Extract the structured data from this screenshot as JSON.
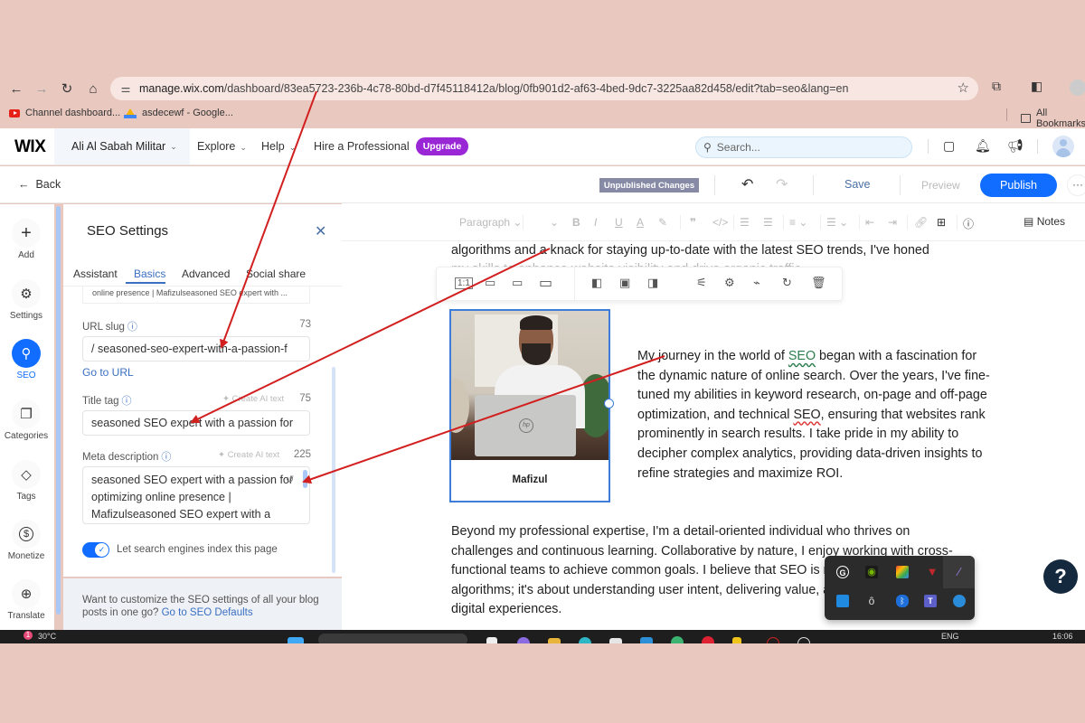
{
  "browser": {
    "url_host": "manage.wix.com",
    "url_path": "/dashboard/83ea5723-236b-4c78-80bd-d7f45118412a/blog/0fb901d2-af63-4bed-9dc7-3225aa82d458/edit?tab=seo&lang=en",
    "bookmarks": [
      {
        "label": "Channel dashboard...",
        "icon": "youtube-icon"
      },
      {
        "label": "asdecewf - Google...",
        "icon": "google-drive-icon"
      }
    ],
    "all_bookmarks": "All Bookmarks"
  },
  "wix_header": {
    "logo": "WIX",
    "site_name": "Ali Al Sabah Militar",
    "menu": [
      "Explore",
      "Help",
      "Hire a Professional"
    ],
    "upgrade": "Upgrade",
    "search_placeholder": "Search..."
  },
  "editor_header": {
    "back": "Back",
    "status_badge": "Unpublished Changes",
    "save": "Save",
    "preview": "Preview",
    "publish": "Publish"
  },
  "rail": [
    {
      "label": "Add",
      "icon": "plus-icon",
      "glyph": "+"
    },
    {
      "label": "Settings",
      "icon": "gear-icon",
      "glyph": "⚙"
    },
    {
      "label": "SEO",
      "icon": "search-icon",
      "glyph": "⌕",
      "active": true
    },
    {
      "label": "Categories",
      "icon": "categories-icon",
      "glyph": "❐"
    },
    {
      "label": "Tags",
      "icon": "tag-icon",
      "glyph": "◇"
    },
    {
      "label": "Monetize",
      "icon": "dollar-icon",
      "glyph": "$"
    },
    {
      "label": "Translate",
      "icon": "globe-icon",
      "glyph": "⊕"
    }
  ],
  "seo_panel": {
    "title": "SEO Settings",
    "tabs": [
      "Assistant",
      "Basics",
      "Advanced",
      "Social share"
    ],
    "active_tab": "Basics",
    "truncated_field": "online presence | Mafizulseasoned SEO expert with ...",
    "url_slug": {
      "label": "URL slug",
      "counter": "73",
      "value": "/  seasoned-seo-expert-with-a-passion-f",
      "link": "Go to URL"
    },
    "title_tag": {
      "label": "Title tag",
      "ai": "Create AI text",
      "counter": "75",
      "value": "seasoned SEO expert with a passion for"
    },
    "meta_description": {
      "label": "Meta description",
      "ai": "Create AI text",
      "counter": "225",
      "value": "seasoned SEO expert with a passion for optimizing online presence | Mafizulseasoned SEO expert with a"
    },
    "index_toggle": {
      "label": "Let search engines index this page",
      "on": true
    },
    "footer_text": "Want to customize the SEO settings of all your blog posts in one go?",
    "footer_link": "Go to SEO Defaults"
  },
  "editor": {
    "format_toolbar": {
      "paragraph": "Paragraph",
      "notes": "Notes"
    },
    "top_text_line1": "algorithms and a knack for staying up-to-date with the latest SEO trends, I've honed",
    "top_text_line2": "my skills to enhance website visibility and drive organic traffic.",
    "image_caption": "Mafizul",
    "side_paragraph_parts": [
      "My journey in the world of ",
      "SEO",
      " began with a fascination for the dynamic nature of online search. Over the years, I've fine-tuned my abilities in keyword research, on-page and off-page optimization, and technical ",
      "SEO",
      ", ensuring that websites rank prominently in search results. I take pride in my ability to decipher complex analytics, providing data-driven insights to refine strategies and maximize ROI."
    ],
    "paragraph2": "Beyond my professional expertise, I'm a detail-oriented individual who thrives on challenges and continuous learning. Collaborative by nature, I enjoy working with cross-functional teams to achieve common goals. I believe that SEO is not just about algorithms; it's about understanding user intent, delivering value, and building lasting digital experiences."
  },
  "help": "?",
  "taskbar": {
    "weather": "30°C",
    "notification_count": "1",
    "language": "ENG",
    "time": "16:06"
  },
  "colors": {
    "accent": "#116dff",
    "upgrade": "#9a27d5",
    "badge": "#868aa5",
    "annotation": "#d21f1f",
    "background": "#e9c8bf"
  }
}
